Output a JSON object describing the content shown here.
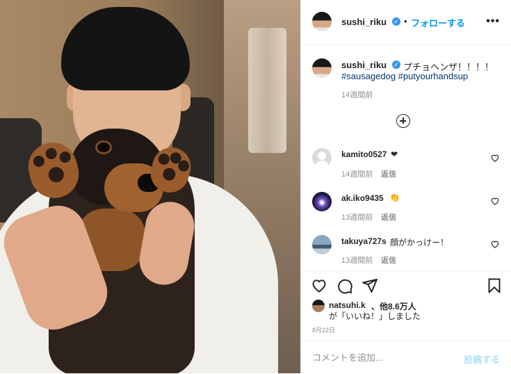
{
  "header": {
    "username": "sushi_riku",
    "verified_symbol": "✓",
    "separator": "•",
    "follow_label": "フォローする",
    "more_symbol": "•••"
  },
  "caption": {
    "username": "sushi_riku",
    "text": "プチョヘンザ！！！！",
    "hashtags": "#sausagedog #putyourhandsup",
    "time": "14週間前"
  },
  "comments": [
    {
      "username": "kamito0527",
      "text": "❤",
      "time": "14週間前",
      "reply": "返信"
    },
    {
      "username": "ak.iko9435",
      "text": "👏",
      "time": "13週間前",
      "reply": "返信"
    },
    {
      "username": "takuya727s",
      "text": "顔がかっけー！",
      "time": "13週間前",
      "reply": "返信"
    }
  ],
  "likes": {
    "username": "natsuhi.k",
    "others": "、他8.6万人",
    "suffix": "が「いいね！」しました"
  },
  "date": "8月22日",
  "comment_box": {
    "placeholder": "コメントを追加...",
    "post_label": "投稿する"
  },
  "colors": {
    "link": "#0095f6",
    "hashtag": "#00376b",
    "verified": "#3897f0",
    "muted": "#8e8e8e",
    "post_disabled": "#b2dffc"
  },
  "icons": [
    "verified-badge-icon",
    "more-options-icon",
    "load-more-comments-icon",
    "comment-like-heart-icon",
    "like-heart-icon",
    "comment-bubble-icon",
    "share-send-icon",
    "save-bookmark-icon"
  ]
}
